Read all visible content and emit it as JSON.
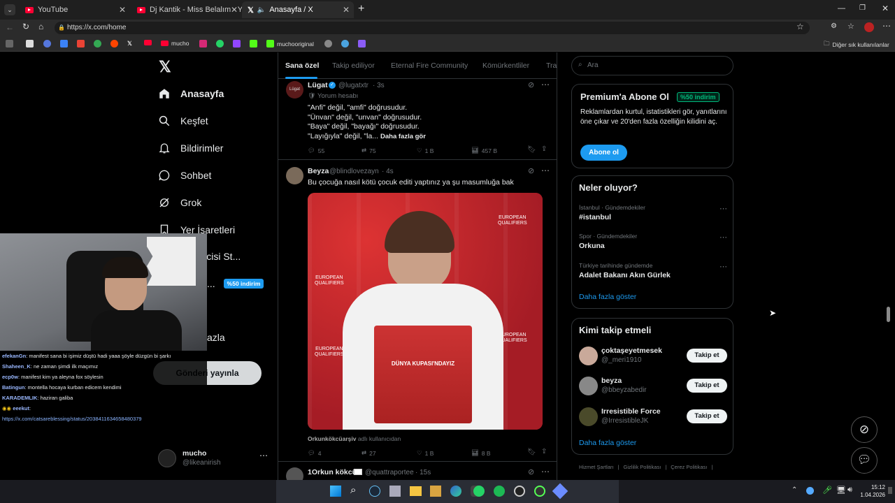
{
  "browser": {
    "tabs": [
      {
        "title": "YouTube"
      },
      {
        "title": "Dj Kantik - Miss Belalım - YouTube"
      },
      {
        "title": "Anasayfa / X"
      }
    ],
    "url": "https://x.com/home",
    "bookmarks": [
      "mucho",
      "muchooriginal"
    ],
    "other_favorites": "Diğer sık kullanılanlar"
  },
  "x": {
    "nav": [
      "Anasayfa",
      "Keşfet",
      "Bildirimler",
      "Sohbet",
      "Grok",
      "Yer İşaretleri",
      "üreticisi St...",
      "...",
      "azla"
    ],
    "premium_badge": "%50 indirim",
    "post_button": "Gönderi yayınla",
    "account": {
      "name": "mucho",
      "handle": "@likeanirish"
    },
    "tabs": [
      "Sana özel",
      "Takip ediliyor",
      "Eternal Fire Community",
      "Kömürkentliler",
      "Tra"
    ],
    "search_placeholder": "Ara",
    "tweets": [
      {
        "name": "Lügat",
        "handle": "@lugatxtr",
        "time": "· 3s",
        "avatar": "Lügat",
        "label": "Yorum hesabı",
        "lines": [
          "\"Anfi\" değil, \"amfi\" doğrusudur.",
          "\"Ünvan\" değil, \"unvan\" doğrusudur.",
          "\"Baya\" değil, \"bayağı\" doğrusudur.",
          "\"Layığıyla\" değil, \"la..."
        ],
        "more": "Daha fazla gör",
        "replies": "55",
        "reposts": "75",
        "likes": "1 B",
        "views": "457 B"
      },
      {
        "name": "Beyza",
        "handle": "@blindlovezayn",
        "time": "· 4s",
        "text": "Bu çocuğa nasıl kötü çocuk editi yaptınız ya şu masumluğa bak",
        "media_caption_user": "Orkunkökcüarşiv",
        "media_caption_suffix": "adlı kullanıcıdan",
        "replies": "4",
        "reposts": "27",
        "likes": "1 B",
        "views": "8 B",
        "media_text": {
          "eq1": "EUROPEAN",
          "eq2": "QUALIFIERS",
          "shirt": "DÜNYA KUPASI'NDAYIZ"
        }
      },
      {
        "name": "1Orkun kökcü",
        "handle": "@quattraportee",
        "time": "· 15s"
      }
    ],
    "premium": {
      "title": "Premium'a Abone Ol",
      "badge": "%50 indirim",
      "text": "Reklamlardan kurtul, istatistikleri gör, yanıtlarını öne çıkar ve 20'den fazla özelliğin kilidini aç.",
      "button": "Abone ol"
    },
    "trends": {
      "title": "Neler oluyor?",
      "items": [
        {
          "context": "İstanbul · Gündemdekiler",
          "name": "#istanbul"
        },
        {
          "context": "Spor · Gündemdekiler",
          "name": "Orkuna"
        },
        {
          "context": "Türkiye tarihinde gündemde",
          "name": "Adalet Bakanı Akın Gürlek"
        }
      ],
      "more": "Daha fazla göster"
    },
    "who_to_follow": {
      "title": "Kimi takip etmeli",
      "items": [
        {
          "name": "çoktaşeyetmesek",
          "handle": "@_meri1910"
        },
        {
          "name": "beyza",
          "handle": "@bbeyzabedir"
        },
        {
          "name": "Irresistible Force",
          "handle": "@IrresistibleJK"
        }
      ],
      "button": "Takip et",
      "more": "Daha fazla göster"
    },
    "footer": [
      "Hizmet Şartları",
      "|",
      "Gizlilik Politikası",
      "|",
      "Çerez Politikası",
      "|"
    ]
  },
  "stream": {
    "chat": [
      {
        "user": "efekanGn",
        "msg": ": manifest sana bi işimiz düştü hadi yaaa şöyle düzgün bi şarkı"
      },
      {
        "user": "Shaheen_K",
        "msg": ": ne zaman şimdi ilk maçımız"
      },
      {
        "user": "ecp0w",
        "msg": ": manifest kim ya aleyna fox söylesin"
      },
      {
        "user": "Batingun",
        "msg": ": montella hocaya kurban edicem kendimi"
      },
      {
        "user": "KARADEMLIK",
        "msg": ": haziran galiba"
      },
      {
        "user": "eeekut",
        "msg": ":"
      }
    ],
    "chat_link": "https://x.com/catsareblessing/status/2038411634658480379"
  },
  "taskbar": {
    "time": "15:12",
    "date": "1.04.2026"
  }
}
